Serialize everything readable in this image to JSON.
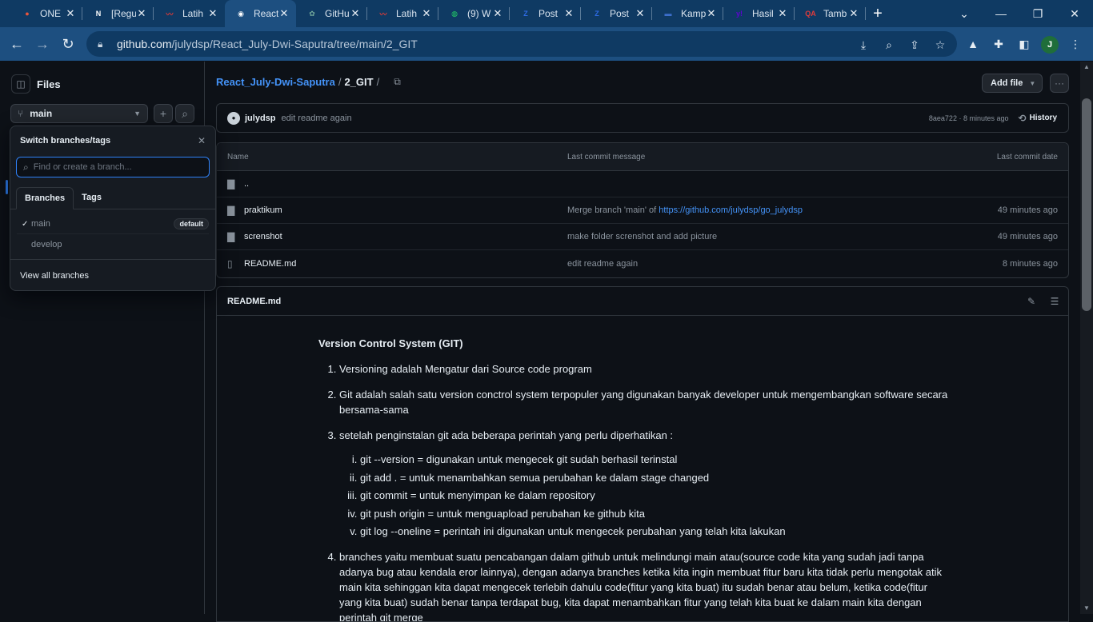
{
  "browser": {
    "tabs": [
      {
        "label": "ONE",
        "icon": "dot-icon",
        "color": "#e8553d"
      },
      {
        "label": "[Regu",
        "icon": "notion-icon",
        "color": "#ffffff"
      },
      {
        "label": "Latih",
        "icon": "red-swoosh-icon",
        "color": "#d13a3a"
      },
      {
        "label": "React",
        "icon": "github-icon",
        "color": "#ffffff"
      },
      {
        "label": "GitHu",
        "icon": "chatgpt-icon",
        "color": "#74aa9c"
      },
      {
        "label": "Latih",
        "icon": "red-swoosh-icon",
        "color": "#d13a3a"
      },
      {
        "label": "(9) W",
        "icon": "whatsapp-icon",
        "color": "#25d366"
      },
      {
        "label": "Post",
        "icon": "z-icon",
        "color": "#2d6ae3"
      },
      {
        "label": "Post",
        "icon": "z-icon",
        "color": "#2d6ae3"
      },
      {
        "label": "Kamp",
        "icon": "flag-icon",
        "color": "#3c6ecb"
      },
      {
        "label": "Hasil",
        "icon": "yahoo-icon",
        "color": "#6001d2"
      },
      {
        "label": "Tamb",
        "icon": "qa-icon",
        "color": "#e03b3b"
      }
    ],
    "active_tab": 3,
    "url_host": "github.com",
    "url_path": "/julydsp/React_July-Dwi-Saputra/tree/main/2_GIT",
    "profile_initial": "J"
  },
  "sidebar": {
    "title": "Files",
    "branch": "main",
    "popover": {
      "title": "Switch branches/tags",
      "search_placeholder": "Find or create a branch...",
      "tabs": [
        "Branches",
        "Tags"
      ],
      "branches": [
        {
          "name": "main",
          "checked": true,
          "badge": "default"
        },
        {
          "name": "develop",
          "checked": false,
          "badge": ""
        }
      ],
      "footer": "View all branches"
    }
  },
  "main": {
    "repo": "React_July-Dwi-Saputra",
    "folder": "2_GIT",
    "add_file": "Add file",
    "commit": {
      "author": "julydsp",
      "message": "edit readme again",
      "meta": "8aea722 · 8 minutes ago",
      "history": "History"
    },
    "table": {
      "headers": [
        "Name",
        "Last commit message",
        "Last commit date"
      ],
      "rows": [
        {
          "name": "..",
          "icon": "folder-icon",
          "msg": "",
          "link": "",
          "date": ""
        },
        {
          "name": "praktikum",
          "icon": "folder-icon",
          "msg": "Merge branch 'main' of ",
          "link": "https://github.com/julydsp/go_julydsp",
          "date": "49 minutes ago"
        },
        {
          "name": "screnshot",
          "icon": "folder-icon",
          "msg": "make folder screnshot and add picture",
          "link": "",
          "date": "49 minutes ago"
        },
        {
          "name": "README.md",
          "icon": "file-icon",
          "msg": "edit readme again",
          "link": "",
          "date": "8 minutes ago"
        }
      ]
    },
    "readme": {
      "filename": "README.md",
      "heading": "Version Control System (GIT)",
      "items": [
        "Versioning adalah Mengatur dari Source code program",
        "Git adalah salah satu version conctrol system terpopuler yang digunakan banyak developer untuk mengembangkan software secara bersama-sama",
        "setelah penginstalan git ada beberapa perintah yang perlu diperhatikan :",
        "branches yaitu membuat suatu pencabangan dalam github untuk melindungi main atau(source code kita yang sudah jadi tanpa adanya bug atau kendala eror lainnya), dengan adanya branches ketika kita ingin membuat fitur baru kita tidak perlu mengotak atik main kita sehinggan kita dapat mengecek terlebih dahulu code(fitur yang kita buat) itu sudah benar atau belum, ketika code(fitur yang kita buat) sudah benar tanpa terdapat bug, kita dapat menambahkan fitur yang telah kita buat ke dalam main kita dengan perintah git merge"
      ],
      "subitems": [
        "git --version = digunakan untuk mengecek git sudah berhasil terinstal",
        "git add . = untuk menambahkan semua perubahan ke dalam stage changed",
        "git commit = untuk menyimpan ke dalam repository",
        "git push origin = untuk menguapload perubahan ke github kita",
        "git log --oneline = perintah ini digunakan untuk mengecek perubahan yang telah kita lakukan"
      ]
    }
  }
}
